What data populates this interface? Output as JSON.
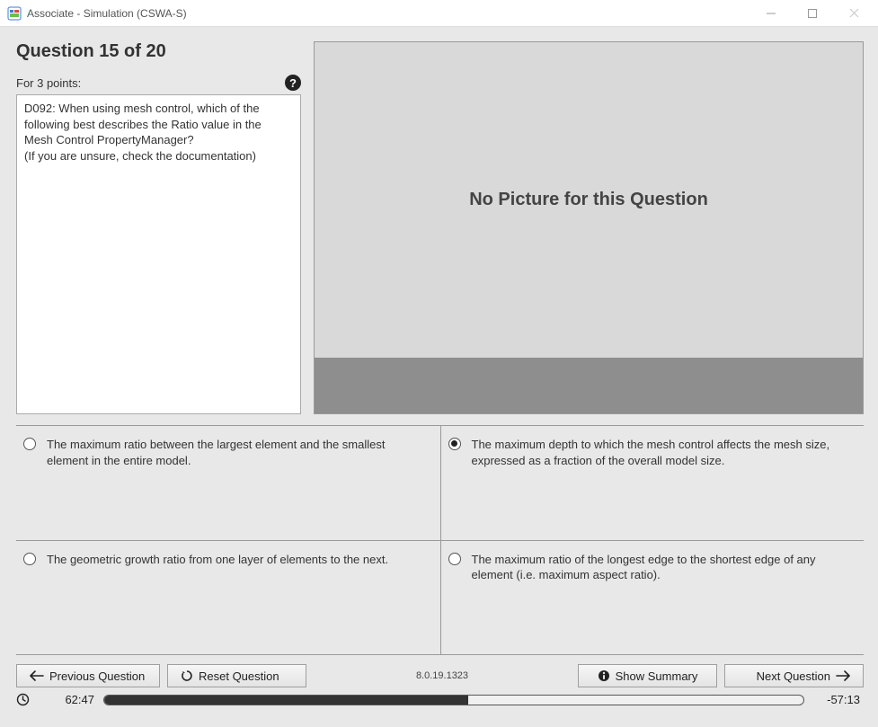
{
  "window": {
    "title": "Associate - Simulation (CSWA-S)"
  },
  "question": {
    "title": "Question 15 of 20",
    "points_label": "For 3 points:",
    "body_line1": "D092: When using mesh control, which of the following best describes the Ratio value in the Mesh Control PropertyManager?",
    "body_line2": "(If you are unsure, check the documentation)"
  },
  "picture": {
    "placeholder": "No Picture for this Question"
  },
  "answers": {
    "a": "The maximum ratio between the largest element and the smallest element in the entire model.",
    "b": "The maximum depth to which the mesh control affects the mesh size, expressed as a fraction of the overall model size.",
    "c": "The geometric growth ratio from one layer of elements to the next.",
    "d": "The maximum ratio of the longest edge to the shortest edge of any element (i.e. maximum aspect ratio).",
    "selected": "b"
  },
  "buttons": {
    "previous": "Previous Question",
    "reset": "Reset Question",
    "summary": "Show Summary",
    "next": "Next Question"
  },
  "footer": {
    "version": "8.0.19.1323"
  },
  "timer": {
    "elapsed": "62:47",
    "remaining": "-57:13"
  }
}
